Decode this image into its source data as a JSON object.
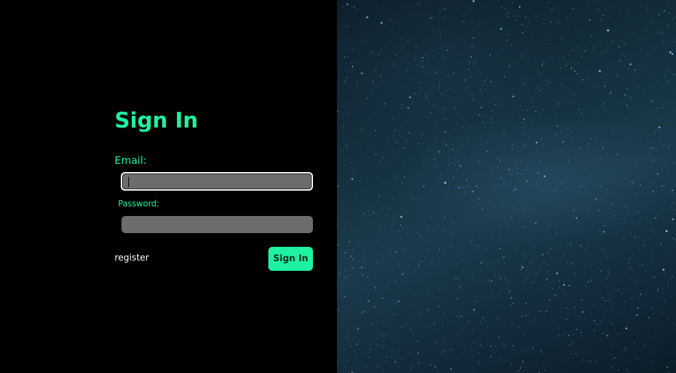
{
  "form": {
    "title": "Sign In",
    "email_label": "Email:",
    "email_value": "",
    "password_label": "Password:",
    "password_value": "",
    "register_label": "register",
    "submit_label": "Sign In"
  },
  "colors": {
    "accent": "#1ef2a0",
    "left_background": "#000000",
    "input_background": "#6c6c6c",
    "sky_background": "#15303f"
  },
  "image": {
    "name": "starry-night-sky"
  }
}
